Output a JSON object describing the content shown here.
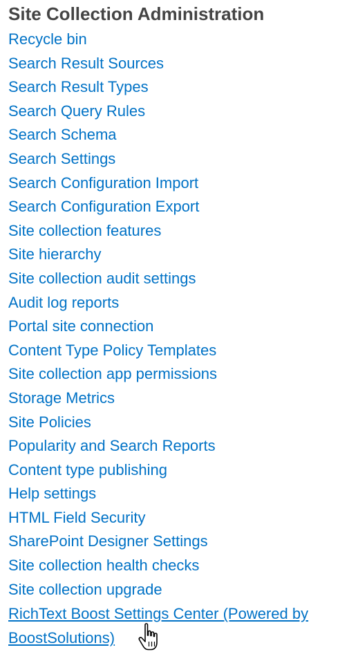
{
  "section": {
    "title": "Site Collection Administration"
  },
  "links": [
    {
      "label": "Recycle bin"
    },
    {
      "label": "Search Result Sources"
    },
    {
      "label": "Search Result Types"
    },
    {
      "label": "Search Query Rules"
    },
    {
      "label": "Search Schema"
    },
    {
      "label": "Search Settings"
    },
    {
      "label": "Search Configuration Import"
    },
    {
      "label": "Search Configuration Export"
    },
    {
      "label": "Site collection features"
    },
    {
      "label": "Site hierarchy"
    },
    {
      "label": "Site collection audit settings"
    },
    {
      "label": "Audit log reports"
    },
    {
      "label": "Portal site connection"
    },
    {
      "label": "Content Type Policy Templates"
    },
    {
      "label": "Site collection app permissions"
    },
    {
      "label": "Storage Metrics"
    },
    {
      "label": "Site Policies"
    },
    {
      "label": "Popularity and Search Reports"
    },
    {
      "label": "Content type publishing"
    },
    {
      "label": "Help settings"
    },
    {
      "label": "HTML Field Security"
    },
    {
      "label": "SharePoint Designer Settings"
    },
    {
      "label": "Site collection health checks"
    },
    {
      "label": "Site collection upgrade"
    },
    {
      "label": "RichText Boost Settings Center (Powered by BoostSolutions)"
    }
  ],
  "colors": {
    "link": "#0072c6",
    "title": "#444444"
  },
  "cursor": {
    "icon": "hand-pointer-icon"
  }
}
